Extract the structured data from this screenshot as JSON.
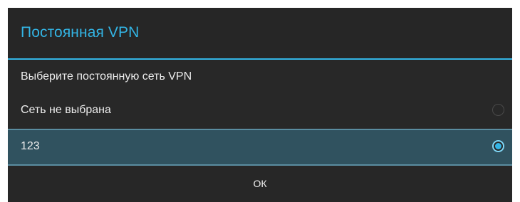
{
  "dialog": {
    "title": "Постоянная VPN",
    "message": "Выберите постоянную сеть VPN",
    "options": [
      {
        "label": "Сеть не выбрана",
        "selected": false
      },
      {
        "label": "123",
        "selected": true
      }
    ],
    "ok_label": "ок"
  },
  "colors": {
    "accent": "#33b5e5",
    "dialog_bg": "#282828",
    "selected_row_bg": "#30525f",
    "text": "#ececec"
  }
}
